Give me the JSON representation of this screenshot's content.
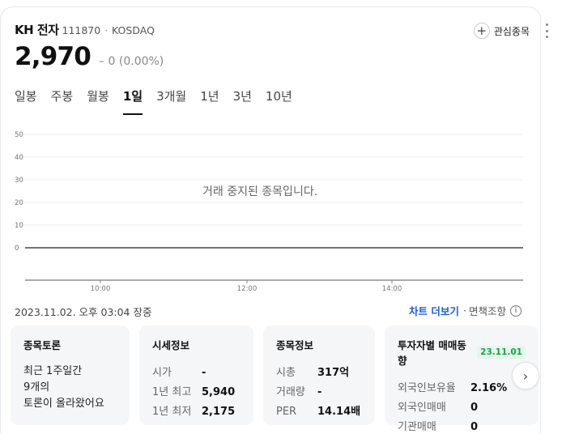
{
  "stock": {
    "name": "KH 전자",
    "code": "111870",
    "separator": "·",
    "market": "KOSDAQ",
    "price": "2,970",
    "change": "– 0 (0.00%)"
  },
  "favorite": {
    "plus": "+",
    "label": "관심종목"
  },
  "tabs": [
    "일봉",
    "주봉",
    "월봉",
    "1일",
    "3개월",
    "1년",
    "3년",
    "10년"
  ],
  "active_tab": "1일",
  "chart_data": {
    "type": "line",
    "y_ticks": [
      "50",
      "40",
      "30",
      "20",
      "10",
      "0"
    ],
    "ylim": [
      0,
      50
    ],
    "x_ticks": [
      "10:00",
      "12:00",
      "14:00"
    ],
    "series": [
      {
        "values": [
          0,
          0
        ]
      }
    ],
    "message": "거래 중지된 종목입니다."
  },
  "footer": {
    "datetime": "2023.11.02. 오후 03:04 장중",
    "chart_more": "차트 더보기",
    "separator": "·",
    "disclaimer": "면책조항",
    "info_glyph": "i"
  },
  "panels": {
    "talk": {
      "title": "종목토론",
      "line1": "최근 1주일간",
      "line2": "9개의",
      "line3": "토론이 올라왔어요"
    },
    "quote": {
      "title": "시세정보",
      "rows": [
        {
          "k": "시가",
          "v": "-"
        },
        {
          "k": "1년 최고",
          "v": "5,940"
        },
        {
          "k": "1년 최저",
          "v": "2,175"
        }
      ]
    },
    "info": {
      "title": "종목정보",
      "rows": [
        {
          "k": "시총",
          "v": "317억"
        },
        {
          "k": "거래량",
          "v": "-"
        },
        {
          "k": "PER",
          "v": "14.14배"
        }
      ]
    },
    "investor": {
      "title": "투자자별 매매동향",
      "date": "23.11.01",
      "rows": [
        {
          "k": "외국인보유율",
          "v": "2.16%"
        },
        {
          "k": "외국인매매",
          "v": "0"
        },
        {
          "k": "기관매매",
          "v": "0"
        }
      ]
    }
  },
  "next_glyph": "›"
}
